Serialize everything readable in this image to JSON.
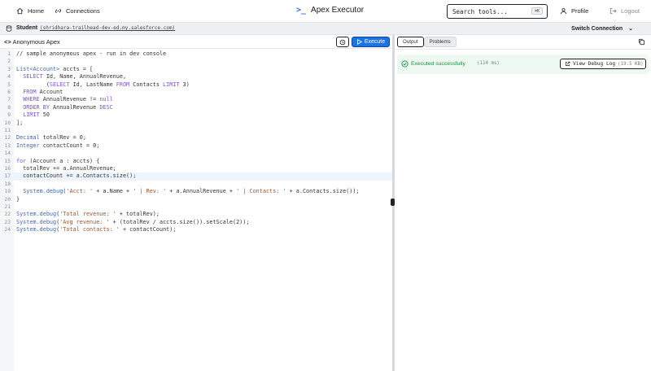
{
  "topbar": {
    "home_label": "Home",
    "connections_label": "Connections",
    "app_title": "Apex Executor",
    "app_icon": ">_",
    "search_placeholder": "Search tools...",
    "search_shortcut": "⌘K",
    "profile_label": "Profile",
    "logout_label": "Logout"
  },
  "connection": {
    "name": "Student",
    "url": "(shridhara-trailhead-dev-ed.my.salesforce.com)",
    "switch_label": "Switch Connection"
  },
  "editor": {
    "title": "Anonymous Apex",
    "execute_label": "Execute",
    "active_line": 17,
    "lines": [
      {
        "n": "1",
        "text": "// sample anonymous apex - run in dev console"
      },
      {
        "n": "2",
        "text": ""
      },
      {
        "n": "3",
        "text": "List<Account> accts = ["
      },
      {
        "n": "4",
        "text": "  SELECT Id, Name, AnnualRevenue,"
      },
      {
        "n": "5",
        "text": "         (SELECT Id, LastName FROM Contacts LIMIT 3)"
      },
      {
        "n": "6",
        "text": "  FROM Account"
      },
      {
        "n": "7",
        "text": "  WHERE AnnualRevenue != null"
      },
      {
        "n": "8",
        "text": "  ORDER BY AnnualRevenue DESC"
      },
      {
        "n": "9",
        "text": "  LIMIT 50"
      },
      {
        "n": "10",
        "text": "];"
      },
      {
        "n": "11",
        "text": ""
      },
      {
        "n": "12",
        "text": "Decimal totalRev = 0;"
      },
      {
        "n": "13",
        "text": "Integer contactCount = 0;"
      },
      {
        "n": "14",
        "text": ""
      },
      {
        "n": "15",
        "text": "for (Account a : accts) {"
      },
      {
        "n": "16",
        "text": "  totalRev += a.AnnualRevenue;"
      },
      {
        "n": "17",
        "text": "  contactCount += a.Contacts.size();"
      },
      {
        "n": "18",
        "text": ""
      },
      {
        "n": "19",
        "text": "  System.debug('Acct: ' + a.Name + ' | Rev: ' + a.AnnualRevenue + ' | Contacts: ' + a.Contacts.size());"
      },
      {
        "n": "20",
        "text": "}"
      },
      {
        "n": "21",
        "text": ""
      },
      {
        "n": "22",
        "text": "System.debug('Total revenue: ' + totalRev);"
      },
      {
        "n": "23",
        "text": "System.debug('Avg revenue: ' + (totalRev / accts.size()).setScale(2));"
      },
      {
        "n": "24",
        "text": "System.debug('Total contacts: ' + contactCount);"
      }
    ]
  },
  "results": {
    "tab_output": "Output",
    "tab_problems": "Problems",
    "status_message": "Executed successfully",
    "duration": "(114 ms)",
    "log_button_label": "View Debug Log",
    "log_size": "(19.5 KB)"
  },
  "colors": {
    "accent": "#1a73e8",
    "success": "#1e8e3e",
    "success_bg": "#eefaf1"
  }
}
